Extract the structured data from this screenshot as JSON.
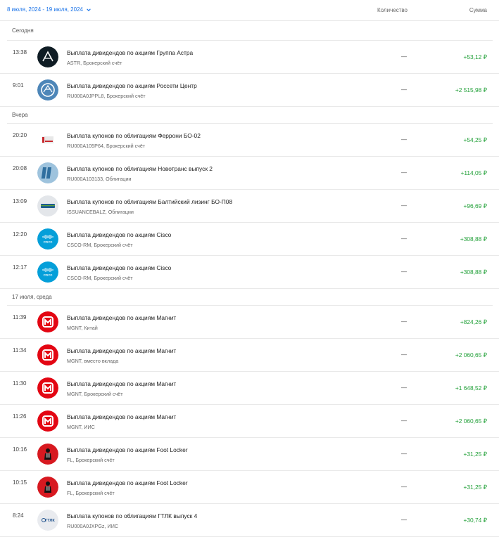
{
  "header": {
    "date_range": "8 июля, 2024 - 19 июля, 2024",
    "qty_label": "Количество",
    "sum_label": "Сумма"
  },
  "colors": {
    "positive": "#21a038",
    "accent": "#1a73e8"
  },
  "groups": [
    {
      "label": "Сегодня",
      "items": [
        {
          "time": "13:38",
          "title": "Выплата дивидендов по акциям Группа Астра",
          "sub": "ASTR, Брокерский счёт",
          "qty": "—",
          "amount": "+53,12 ₽",
          "logo": "astra-logo"
        },
        {
          "time": "9:01",
          "title": "Выплата дивидендов по акциям Россети Центр",
          "sub": "RU000A0JPPL8, Брокерский счёт",
          "qty": "—",
          "amount": "+2 515,98 ₽",
          "logo": "rosseti-logo"
        }
      ]
    },
    {
      "label": "Вчера",
      "items": [
        {
          "time": "20:20",
          "title": "Выплата купонов по облигациям Феррони БО-02",
          "sub": "RU000A105P64, Брокерский счёт",
          "qty": "—",
          "amount": "+54,25 ₽",
          "logo": "ferroni-logo"
        },
        {
          "time": "20:08",
          "title": "Выплата купонов по облигациям Новотранс выпуск 2",
          "sub": "RU000A103133, Облигации",
          "qty": "—",
          "amount": "+114,05 ₽",
          "logo": "novotrans-logo"
        },
        {
          "time": "13:09",
          "title": "Выплата купонов по облигациям Балтийский лизинг БО-П08",
          "sub": "ISSUANCEBALZ, Облигации",
          "qty": "—",
          "amount": "+96,69 ₽",
          "logo": "baltlease-logo"
        },
        {
          "time": "12:20",
          "title": "Выплата дивидендов по акциям Cisco",
          "sub": "CSCO-RM, Брокерский счёт",
          "qty": "—",
          "amount": "+308,88 ₽",
          "logo": "cisco-logo"
        },
        {
          "time": "12:17",
          "title": "Выплата дивидендов по акциям Cisco",
          "sub": "CSCO-RM, Брокерский счёт",
          "qty": "—",
          "amount": "+308,88 ₽",
          "logo": "cisco-logo"
        }
      ]
    },
    {
      "label": "17 июля, среда",
      "items": [
        {
          "time": "11:39",
          "title": "Выплата дивидендов по акциям Магнит",
          "sub": "MGNT, Китай",
          "qty": "—",
          "amount": "+824,26 ₽",
          "logo": "magnit-logo"
        },
        {
          "time": "11:34",
          "title": "Выплата дивидендов по акциям Магнит",
          "sub": "MGNT, вместо вклада",
          "qty": "—",
          "amount": "+2 060,65 ₽",
          "logo": "magnit-logo"
        },
        {
          "time": "11:30",
          "title": "Выплата дивидендов по акциям Магнит",
          "sub": "MGNT, Брокерский счёт",
          "qty": "—",
          "amount": "+1 648,52 ₽",
          "logo": "magnit-logo"
        },
        {
          "time": "11:26",
          "title": "Выплата дивидендов по акциям Магнит",
          "sub": "MGNT, ИИС",
          "qty": "—",
          "amount": "+2 060,65 ₽",
          "logo": "magnit-logo"
        },
        {
          "time": "10:16",
          "title": "Выплата дивидендов по акциям Foot Locker",
          "sub": "FL, Брокерский счёт",
          "qty": "—",
          "amount": "+31,25 ₽",
          "logo": "footlocker-logo"
        },
        {
          "time": "10:15",
          "title": "Выплата дивидендов по акциям Foot Locker",
          "sub": "FL, Брокерский счёт",
          "qty": "—",
          "amount": "+31,25 ₽",
          "logo": "footlocker-logo"
        },
        {
          "time": "8:24",
          "title": "Выплата купонов по облигациям ГТЛК выпуск 4",
          "sub": "RU000A0JXPGz, ИИС",
          "qty": "—",
          "amount": "+30,74 ₽",
          "logo": "gtlk-logo"
        }
      ]
    }
  ]
}
